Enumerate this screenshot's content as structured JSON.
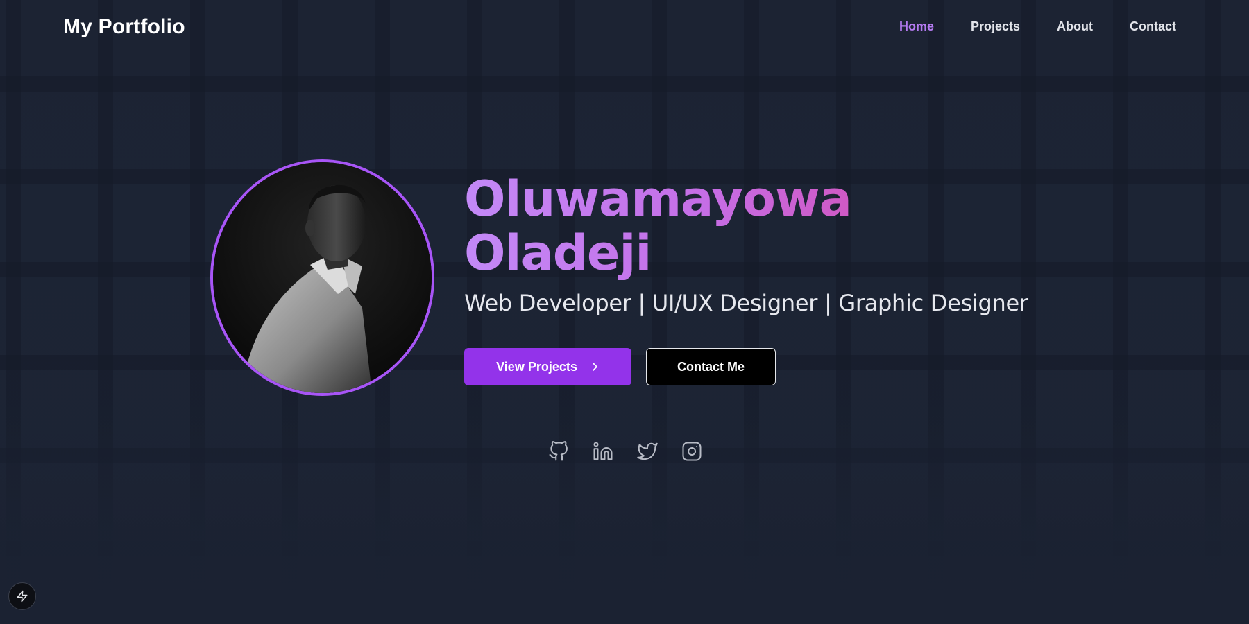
{
  "header": {
    "logo": "My Portfolio",
    "nav": [
      {
        "label": "Home",
        "active": true
      },
      {
        "label": "Projects",
        "active": false
      },
      {
        "label": "About",
        "active": false
      },
      {
        "label": "Contact",
        "active": false
      }
    ]
  },
  "hero": {
    "name_line1": "Oluwamayowa",
    "name_line2": "Oladeji",
    "subtitle": "Web Developer | UI/UX Designer | Graphic Designer",
    "primary_button": "View Projects",
    "secondary_button": "Contact Me"
  },
  "social": [
    {
      "icon": "github-icon"
    },
    {
      "icon": "linkedin-icon"
    },
    {
      "icon": "twitter-icon"
    },
    {
      "icon": "instagram-icon"
    }
  ],
  "colors": {
    "accent": "#a855f7",
    "button_primary": "#9333ea",
    "nav_active": "#b57bf2",
    "gradient_start": "#c389f7",
    "gradient_end": "#d946a6",
    "background": "#1c2333"
  }
}
